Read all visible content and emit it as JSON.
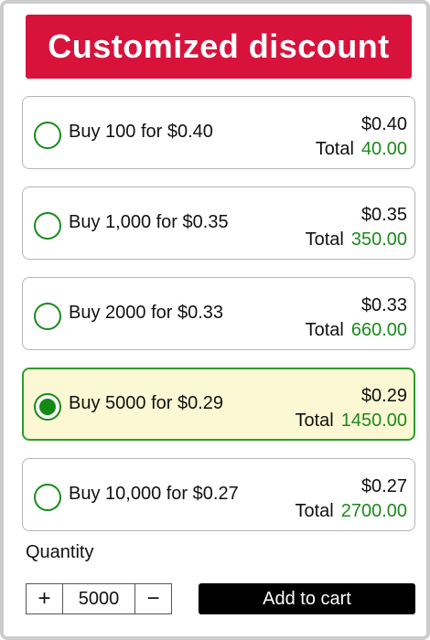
{
  "title": "Customized discount",
  "options": [
    {
      "label": "Buy 100 for $0.40",
      "unit_price": "$0.40",
      "total_label": "Total",
      "total_value": "40.00",
      "selected": false
    },
    {
      "label": "Buy 1,000 for $0.35",
      "unit_price": "$0.35",
      "total_label": "Total",
      "total_value": "350.00",
      "selected": false
    },
    {
      "label": "Buy 2000 for $0.33",
      "unit_price": "$0.33",
      "total_label": "Total",
      "total_value": "660.00",
      "selected": false
    },
    {
      "label": "Buy 5000 for $0.29",
      "unit_price": "$0.29",
      "total_label": "Total",
      "total_value": "1450.00",
      "selected": true
    },
    {
      "label": "Buy 10,000 for $0.27",
      "unit_price": "$0.27",
      "total_label": "Total",
      "total_value": "2700.00",
      "selected": false
    }
  ],
  "quantity": {
    "label": "Quantity",
    "value": "5000",
    "increment_glyph": "+",
    "decrement_glyph": "−"
  },
  "add_to_cart_label": "Add to cart",
  "colors": {
    "title_bg": "#d7133c",
    "accent_green": "#1b8a1b",
    "selected_bg": "#fcf8d4",
    "button_bg": "#000000"
  }
}
